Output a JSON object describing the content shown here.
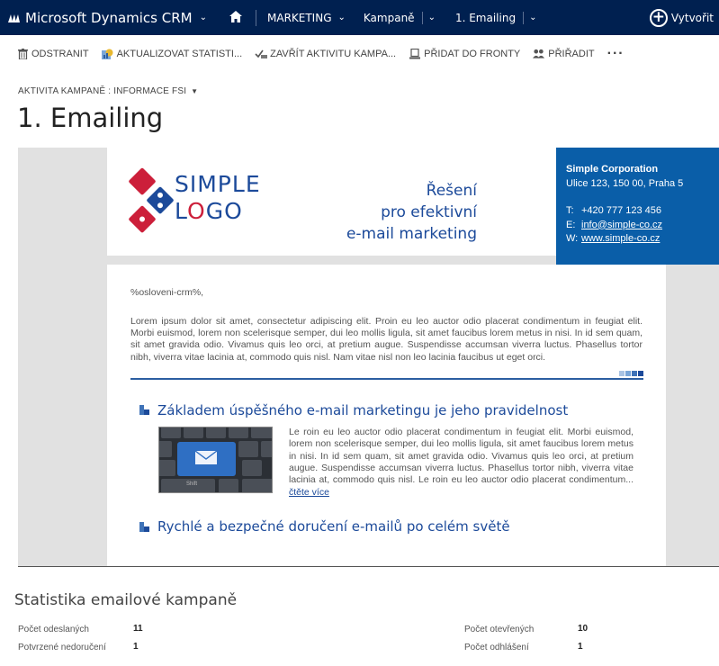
{
  "topnav": {
    "brand": "Microsoft Dynamics CRM",
    "area": "MARKETING",
    "entity": "Kampaně",
    "record": "1. Emailing",
    "create_label": "Vytvořit"
  },
  "commands": [
    {
      "icon": "trash-icon",
      "label": "ODSTRANIT"
    },
    {
      "icon": "refresh-stats-icon",
      "label": "AKTUALIZOVAT STATISTI..."
    },
    {
      "icon": "close-activity-icon",
      "label": "ZAVŘÍT AKTIVITU KAMPA..."
    },
    {
      "icon": "queue-icon",
      "label": "PŘIDAT DO FRONTY"
    },
    {
      "icon": "assign-icon",
      "label": "PŘIŘADIT"
    }
  ],
  "form": {
    "selector": "AKTIVITA KAMPANĚ : INFORMACE FSI",
    "title": "1. Emailing"
  },
  "email": {
    "logo_line1": "SIMPLE",
    "logo_line2_a": "L",
    "logo_line2_o": "O",
    "logo_line2_b": "GO",
    "tagline": [
      "Řešení",
      "pro efektivní",
      "e-mail marketing"
    ],
    "contact": {
      "company": "Simple Corporation",
      "address": "Ulice 123, 150 00, Praha 5",
      "phone_key": "T:",
      "phone": "+420 777 123 456",
      "email_key": "E:",
      "email": "info@simple-co.cz",
      "web_key": "W:",
      "web": "www.simple-co.cz"
    },
    "greeting": "%osloveni-crm%,",
    "intro": "Lorem ipsum dolor sit amet, consectetur adipiscing elit. Proin eu leo auctor odio placerat condimentum in feugiat elit. Morbi euismod, lorem non scelerisque semper, dui leo mollis ligula, sit amet faucibus lorem metus in nisi. In id sem quam, sit amet gravida odio. Vivamus quis leo orci, at pretium augue. Suspendisse accumsan viverra luctus. Phasellus tortor nibh, viverra vitae lacinia at, commodo quis nisl. Nam vitae nisl non leo lacinia faucibus ut eget orci.",
    "article1": {
      "title": "Základem úspěšného e-mail marketingu je jeho pravidelnost",
      "text": "Le roin eu leo auctor odio placerat condimentum in feugiat elit. Morbi euismod, lorem non scelerisque semper, dui leo mollis ligula, sit amet faucibus lorem metus in nisi. In id sem quam, sit amet gravida odio. Vivamus quis leo orci, at pretium augue. Suspendisse accumsan viverra luctus. Phasellus tortor nibh, viverra vitae lacinia at, commodo quis nisl. Le roin eu leo auctor odio placerat condimentum...",
      "more": "čtěte více",
      "key_label": "Shift"
    },
    "article2": {
      "title": "Rychlé a bezpečné doručení e-mailů po celém světě"
    }
  },
  "stats": {
    "title": "Statistika emailové kampaně",
    "sent_label": "Počet odeslaných",
    "sent_value": "11",
    "bounced_label": "Potvrzené nedoručení",
    "bounced_value": "1",
    "opened_label": "Počet otevřených",
    "opened_value": "10",
    "unsub_label": "Počet odhlášení",
    "unsub_value": "1"
  },
  "colors": {
    "nav_bg": "#002050",
    "brand_blue": "#1c4a9a",
    "brand_red": "#cc1f3a",
    "contact_bg": "#0a5ea8"
  }
}
